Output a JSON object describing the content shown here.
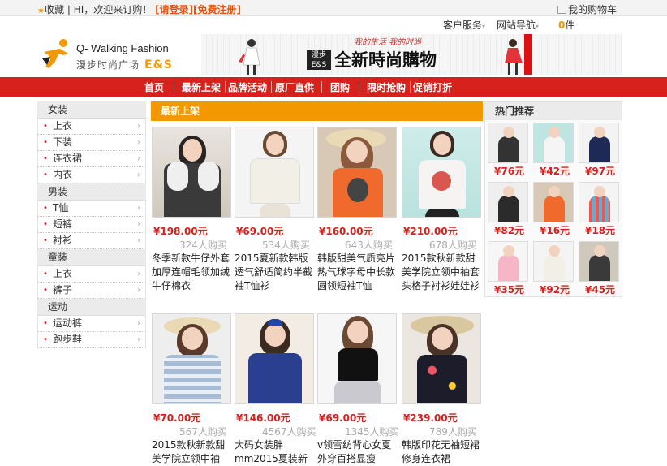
{
  "topbar": {
    "favorite": "收藏",
    "welcome": "| HI，欢迎来订购！",
    "login": "[请登录]",
    "register": "[免费注册]",
    "cart_label": "我的购物车"
  },
  "service": {
    "customer": "客户服务",
    "sitenav": "网站导航",
    "cart_count": "0",
    "cart_unit": "件"
  },
  "logo": {
    "brand": "Q- Walking Fashion",
    "cn": "漫步时尚广场",
    "es": "E&S"
  },
  "banner": {
    "slogan": "我的生活 我的时尚",
    "badge": "漫步 E&S",
    "headline": "全新時尚購物"
  },
  "nav": {
    "items": [
      "首页",
      "最新上架",
      "品牌活动",
      "原厂直供",
      "团购",
      "限时抢购",
      "促销打折"
    ]
  },
  "sidebar": {
    "groups": [
      {
        "label": "女装",
        "items": [
          "上衣",
          "下装",
          "连衣裙",
          "内衣"
        ]
      },
      {
        "label": "男装",
        "items": [
          "T恤",
          "短裤",
          "衬衫"
        ]
      },
      {
        "label": "童装",
        "items": [
          "上衣",
          "裤子"
        ]
      },
      {
        "label": "运动",
        "items": [
          "运动裤",
          "跑步鞋"
        ]
      }
    ]
  },
  "main": {
    "section_title": "最新上架",
    "products": [
      {
        "price": "¥198.00元",
        "sold": "324人购买",
        "title": "冬季新款牛仔外套加厚连帽毛领加绒牛仔棉衣"
      },
      {
        "price": "¥69.00元",
        "sold": "534人购买",
        "title": "2015夏新款韩版透气舒适简约半截袖T恤衫"
      },
      {
        "price": "¥160.00元",
        "sold": "643人购买",
        "title": "韩版甜美气质亮片热气球字母中长款圆领短袖T恤"
      },
      {
        "price": "¥210.00元",
        "sold": "678人购买",
        "title": "2015款秋新款甜美学院立领中袖套头格子衬衫娃娃衫"
      },
      {
        "price": "¥70.00元",
        "sold": "567人购买",
        "title": "2015款秋新款甜美学院立领中袖"
      },
      {
        "price": "¥146.00元",
        "sold": "4567人购买",
        "title": "大码女装胖mm2015夏装新"
      },
      {
        "price": "¥69.00元",
        "sold": "1345人购买",
        "title": "v领雪纺背心女夏外穿百搭显瘦"
      },
      {
        "price": "¥239.00元",
        "sold": "789人购买",
        "title": "韩版印花无袖短裙修身连衣裙"
      }
    ]
  },
  "hot": {
    "title": "热门推荐",
    "items": [
      {
        "price": "¥76元"
      },
      {
        "price": "¥42元"
      },
      {
        "price": "¥97元"
      },
      {
        "price": "¥82元"
      },
      {
        "price": "¥16元"
      },
      {
        "price": "¥18元"
      },
      {
        "price": "¥35元"
      },
      {
        "price": "¥92元"
      },
      {
        "price": "¥45元"
      }
    ]
  },
  "colors": {
    "nav_red": "#d6211d",
    "accent_orange": "#f39800",
    "price_red": "#d6211d"
  }
}
